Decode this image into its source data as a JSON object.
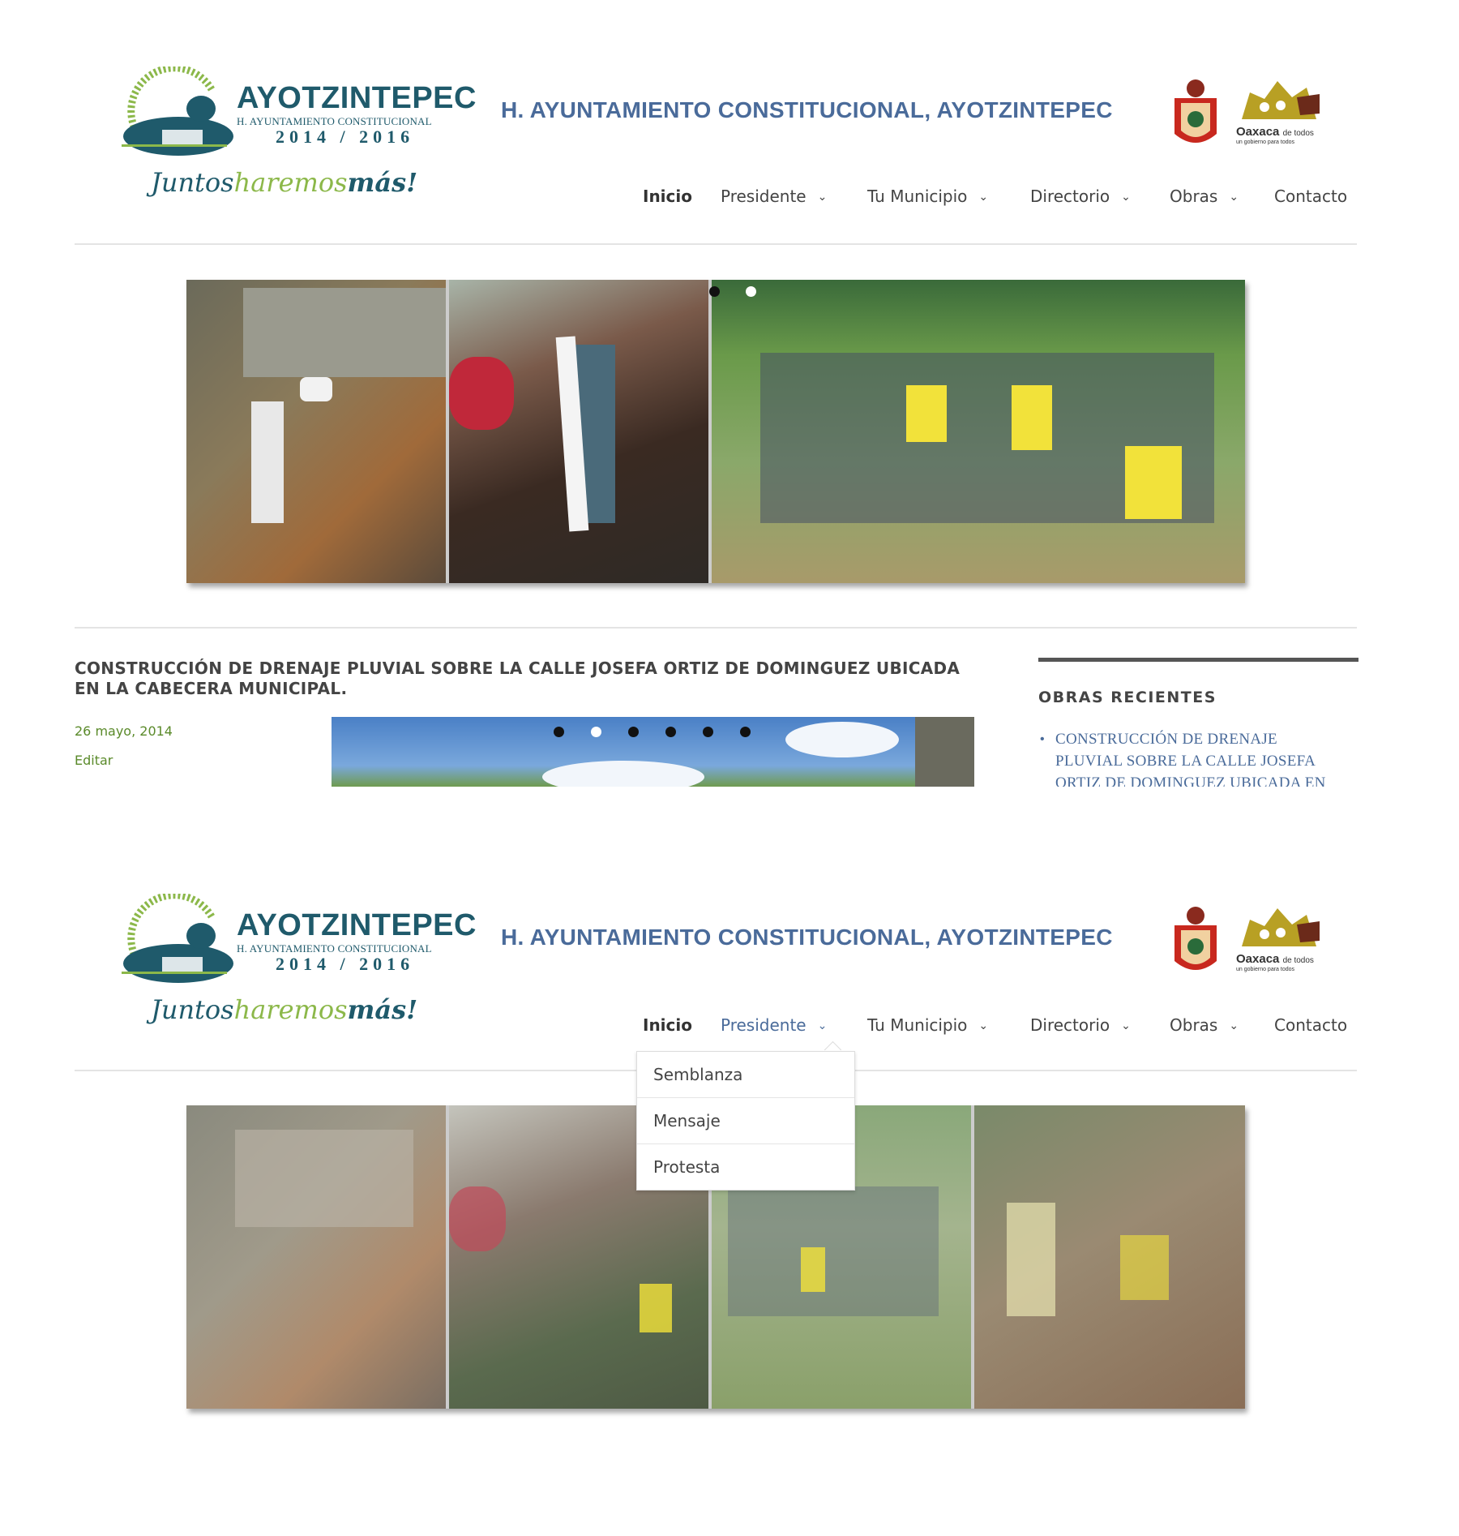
{
  "site": {
    "logo_name": "AYOTZINTEPEC",
    "logo_subtitle": "H. AYUNTAMIENTO CONSTITUCIONAL",
    "logo_years": "2014 / 2016",
    "slogan_1": "Juntos",
    "slogan_2": "haremos",
    "slogan_3": "más!",
    "title": "H. AYUNTAMIENTO CONSTITUCIONAL, AYOTZINTEPEC",
    "state_logo_name": "Oaxaca",
    "state_logo_name_suffix": "de todos",
    "state_logo_tagline": "un gobierno para todos"
  },
  "nav": {
    "items": [
      {
        "label": "Inicio",
        "has_dropdown": false,
        "state": "active"
      },
      {
        "label": "Presidente",
        "has_dropdown": true
      },
      {
        "label": "Tu Municipio",
        "has_dropdown": true
      },
      {
        "label": "Directorio",
        "has_dropdown": true
      },
      {
        "label": "Obras",
        "has_dropdown": true
      },
      {
        "label": "Contacto",
        "has_dropdown": false
      }
    ],
    "chevron": "chevron-down-icon"
  },
  "slider": {
    "dots_shown": 2,
    "active_dot": 1
  },
  "post": {
    "title": "CONSTRUCCIÓN DE DRENAJE PLUVIAL SOBRE LA CALLE JOSEFA ORTIZ DE DOMINGUEZ UBICADA EN LA CABECERA MUNICIPAL.",
    "date": "26 mayo, 2014",
    "edit_label": "Editar",
    "gallery_dots": 6,
    "gallery_active_dot": 2
  },
  "sidebar": {
    "title": "OBRAS RECIENTES",
    "items": [
      {
        "label": "CONSTRUCCIÓN DE DRENAJE PLUVIAL SOBRE LA CALLE JOSEFA ORTIZ DE DOMINGUEZ UBICADA EN LA CABECERA"
      }
    ]
  },
  "dropdown": {
    "parent": "Presidente",
    "items": [
      "Semblanza",
      "Mensaje",
      "Protesta"
    ]
  },
  "colors": {
    "brand_teal": "#1f5a6b",
    "title_blue": "#4a6b9a",
    "accent_green": "#5a8a2a",
    "slogan_green": "#8cb84a"
  }
}
